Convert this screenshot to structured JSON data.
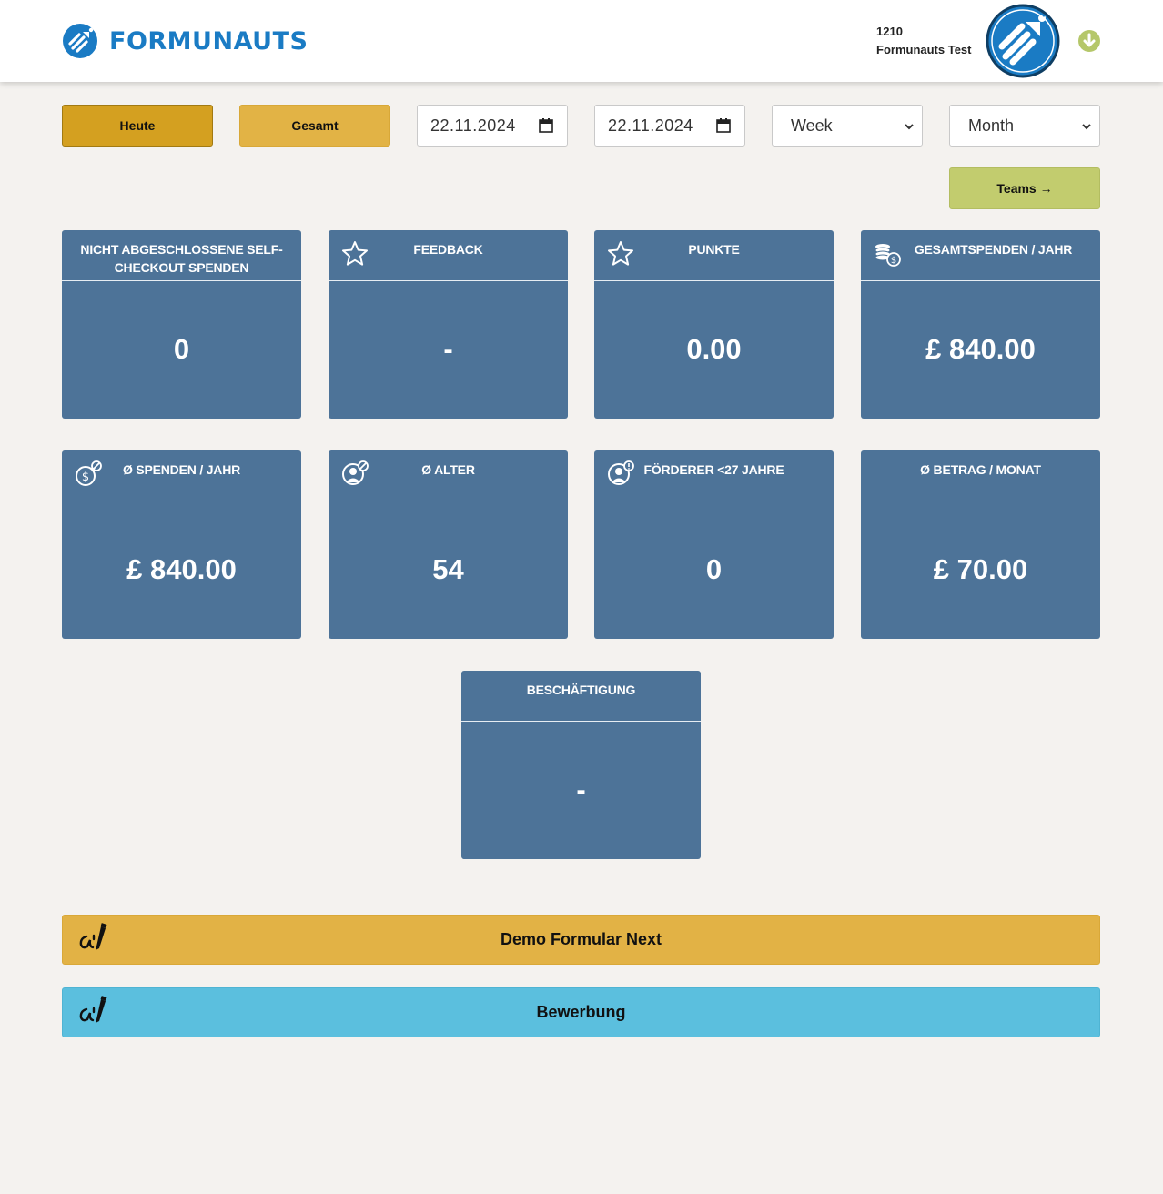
{
  "header": {
    "brand": "FORMUNAUTS",
    "user_id": "1210",
    "user_name": "Formunauts Test",
    "brand_color": "#1a7bc4"
  },
  "toolbar": {
    "today_label": "Heute",
    "total_label": "Gesamt",
    "date_from": "22.11.2024",
    "date_to": "22.11.2024",
    "week_select": {
      "value": "Week"
    },
    "month_select": {
      "value": "Month"
    },
    "teams_label": "Teams →"
  },
  "cards": [
    {
      "title": "NICHT ABGESCHLOSSENE SELF-CHECKOUT SPENDEN",
      "value": "0",
      "icon": "none"
    },
    {
      "title": "FEEDBACK",
      "value": "-",
      "icon": "star-icon"
    },
    {
      "title": "PUNKTE",
      "value": "0.00",
      "icon": "star-icon"
    },
    {
      "title": "GESAMTSPENDEN / JAHR",
      "value": "£ 840.00",
      "icon": "coins-icon"
    },
    {
      "title": "Ø SPENDEN / JAHR",
      "value": "£ 840.00",
      "icon": "dollar-average-icon"
    },
    {
      "title": "Ø ALTER",
      "value": "54",
      "icon": "person-average-icon"
    },
    {
      "title": "FÖRDERER <27 JAHRE",
      "value": "0",
      "icon": "person-info-icon"
    },
    {
      "title": "Ø BETRAG / MONAT",
      "value": "£ 70.00",
      "icon": "none"
    },
    {
      "title": "BESCHÄFTIGUNG",
      "value": "-",
      "icon": "none"
    }
  ],
  "forms": [
    {
      "label": "Demo Formular Next",
      "color": "#e2b245"
    },
    {
      "label": "Bewerbung",
      "color": "#5bbfde"
    }
  ],
  "colors": {
    "card_bg": "#4d7398",
    "page_bg": "#f4f2ef",
    "heute_bg": "#d4a020",
    "gesamt_bg": "#e2b345",
    "teams_bg": "#c2cc6e",
    "user_menu_icon": "#b5c76a"
  }
}
